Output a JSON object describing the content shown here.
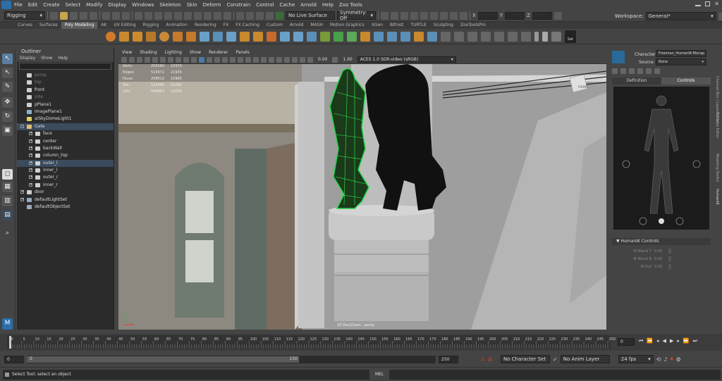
{
  "menubar": {
    "items": [
      "File",
      "Edit",
      "Create",
      "Select",
      "Modify",
      "Display",
      "Windows",
      "Skeleton",
      "Skin",
      "Deform",
      "Constrain",
      "Control",
      "Cache",
      "Arnold",
      "Help",
      "Zoo Tools"
    ]
  },
  "status": {
    "mode": "Rigging",
    "live_surface": "No Live Surface",
    "symmetry": "Symmetry: Off",
    "x_label": "X",
    "y_label": "Y",
    "z_label": "Z",
    "workspace_label": "Workspace:",
    "workspace_value": "General*"
  },
  "shelf": {
    "tabs": [
      "Curves",
      "Surfaces",
      "Poly Modeling",
      "AK",
      "UV Editing",
      "Rigging",
      "Animation",
      "Rendering",
      "FX",
      "FX Caching",
      "Custom",
      "Arnold",
      "MASH",
      "Motion Graphics",
      "XGen",
      "Bifrost",
      "TURTLE",
      "Sculpting",
      "ZooToolsPro"
    ],
    "active_tab": "Poly Modeling",
    "set_label": "Set"
  },
  "toolbox": {
    "maya_badge": "M"
  },
  "outliner": {
    "title": "Outliner",
    "menu": [
      "Display",
      "Show",
      "Help"
    ],
    "items": [
      {
        "label": "persp",
        "indent": 0,
        "icon": "camera-icon",
        "dim": true,
        "sel": false,
        "exp": ""
      },
      {
        "label": "top",
        "indent": 0,
        "icon": "camera-icon",
        "dim": true,
        "sel": false,
        "exp": ""
      },
      {
        "label": "front",
        "indent": 0,
        "icon": "camera-icon",
        "dim": false,
        "sel": false,
        "exp": ""
      },
      {
        "label": "side",
        "indent": 0,
        "icon": "camera-icon",
        "dim": true,
        "sel": false,
        "exp": ""
      },
      {
        "label": "pPlane1",
        "indent": 0,
        "icon": "mesh-icon",
        "dim": false,
        "sel": false,
        "exp": ""
      },
      {
        "label": "imagePlane1",
        "indent": 0,
        "icon": "image-icon",
        "dim": false,
        "sel": false,
        "exp": ""
      },
      {
        "label": "aiSkyDomeLight1",
        "indent": 0,
        "icon": "light-icon",
        "dim": false,
        "sel": false,
        "exp": ""
      },
      {
        "label": "Gate",
        "indent": 0,
        "icon": "group-icon",
        "dim": false,
        "sel": true,
        "exp": "-"
      },
      {
        "label": "face",
        "indent": 1,
        "icon": "mesh-icon",
        "dim": false,
        "sel": false,
        "exp": "+"
      },
      {
        "label": "center",
        "indent": 1,
        "icon": "mesh-icon",
        "dim": false,
        "sel": false,
        "exp": "+"
      },
      {
        "label": "backWall",
        "indent": 1,
        "icon": "mesh-icon",
        "dim": false,
        "sel": false,
        "exp": "+"
      },
      {
        "label": "column_top",
        "indent": 1,
        "icon": "mesh-icon",
        "dim": false,
        "sel": false,
        "exp": "+"
      },
      {
        "label": "outer_l",
        "indent": 1,
        "icon": "mesh-icon",
        "dim": false,
        "sel": true,
        "exp": "+"
      },
      {
        "label": "inner_l",
        "indent": 1,
        "icon": "mesh-icon",
        "dim": false,
        "sel": false,
        "exp": "+"
      },
      {
        "label": "outer_r",
        "indent": 1,
        "icon": "mesh-icon",
        "dim": false,
        "sel": false,
        "exp": "+"
      },
      {
        "label": "inner_r",
        "indent": 1,
        "icon": "mesh-icon",
        "dim": false,
        "sel": false,
        "exp": "+"
      },
      {
        "label": "door",
        "indent": 0,
        "icon": "mesh-icon",
        "dim": false,
        "sel": false,
        "exp": "+"
      },
      {
        "label": "defaultLightSet",
        "indent": 0,
        "icon": "set-icon",
        "dim": false,
        "sel": false,
        "exp": "+"
      },
      {
        "label": "defaultObjectSet",
        "indent": 0,
        "icon": "set-icon",
        "dim": false,
        "sel": false,
        "exp": ""
      }
    ]
  },
  "viewport": {
    "menu": [
      "View",
      "Shading",
      "Lighting",
      "Show",
      "Renderer",
      "Panels"
    ],
    "exposure": "0.00",
    "gamma": "1.00",
    "color_space": "ACES 1.0 SDR-video (sRGB)",
    "hud": [
      {
        "k": "Verts:",
        "a": "258260",
        "b": "10970"
      },
      {
        "k": "Edges:",
        "a": "515672",
        "b": "21935"
      },
      {
        "k": "Faces:",
        "a": "258612",
        "b": "10965"
      },
      {
        "k": "Tris:",
        "a": "515469",
        "b": "21292"
      },
      {
        "k": "UVs:",
        "a": "544853",
        "b": "12054"
      }
    ],
    "camera_label": "2D Pan/Zoom : persp",
    "viewcube": "FRONT"
  },
  "humanik": {
    "character_label": "Character:",
    "character_value": "Freeman_HumanIK:Mocap",
    "source_label": "Source:",
    "source_value": "None",
    "tabs": [
      "Definition",
      "Controls"
    ],
    "active_tab": "Controls",
    "section_title": "HumanIK Controls",
    "blends": [
      {
        "label": "IK Blend T",
        "value": "0.00"
      },
      {
        "label": "IK Blend R",
        "value": "0.00"
      },
      {
        "label": "IK Pull",
        "value": "0.00"
      }
    ],
    "side_tabs": [
      "Channel Box / Layer Editor",
      "Modeling Toolkit",
      "Attribute Editor",
      "HumanIK"
    ]
  },
  "timeline": {
    "ticks": [
      "0",
      "5",
      "10",
      "15",
      "20",
      "25",
      "30",
      "35",
      "40",
      "45",
      "50",
      "55",
      "60",
      "65",
      "70",
      "75",
      "80",
      "85",
      "90",
      "95",
      "100",
      "105",
      "110",
      "115",
      "120",
      "125",
      "130",
      "135",
      "140",
      "145",
      "150",
      "155",
      "160",
      "165",
      "170",
      "175",
      "180",
      "185",
      "190",
      "195",
      "200",
      "205",
      "210",
      "215",
      "220",
      "225",
      "230",
      "235",
      "240",
      "245",
      "250"
    ],
    "current_frame": "0"
  },
  "range": {
    "start": "0",
    "inner_start": "0",
    "mid": "150",
    "end": "250",
    "no_char": "No Character Set",
    "no_layer": "No Anim Layer",
    "fps": "24 fps"
  },
  "helpline": {
    "text": "Select Tool: select an object",
    "mel": "MEL"
  }
}
